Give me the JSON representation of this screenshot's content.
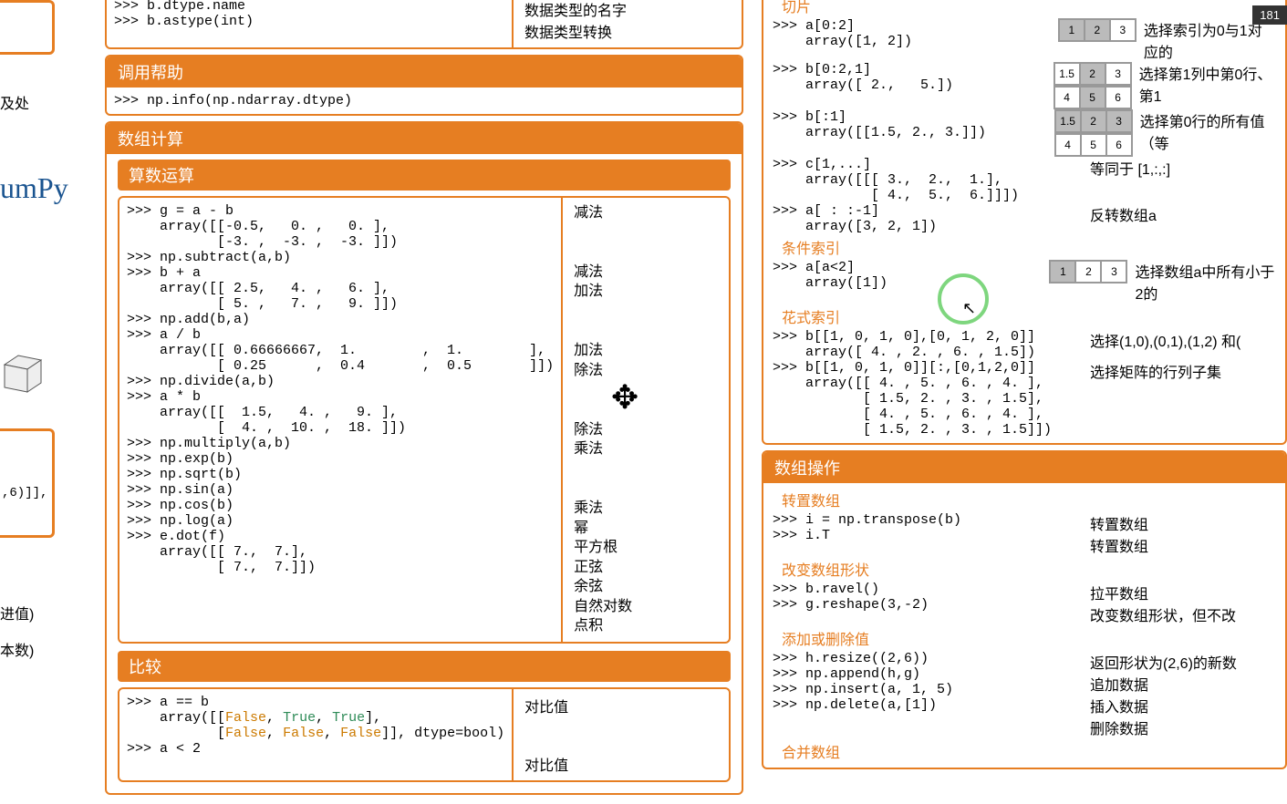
{
  "badge": "181",
  "left": {
    "frag1": "及处",
    "numpy": "umPy",
    "frag2": "进值)",
    "frag3": "本数)"
  },
  "top_code": {
    "l1": ">>> b.dtype.name",
    "l2": ">>> b.astype(int)",
    "d1": "数据类型的名字",
    "d2": "数据类型转换"
  },
  "help": {
    "title": "调用帮助",
    "code": ">>> np.info(np.ndarray.dtype)"
  },
  "calc": {
    "title": "数组计算",
    "arith": {
      "title": "算数运算",
      "code": ">>> g = a - b\n    array([[-0.5,   0. ,   0. ],\n           [-3. ,  -3. ,  -3. ]])\n>>> np.subtract(a,b)\n>>> b + a\n    array([[ 2.5,   4. ,   6. ],\n           [ 5. ,   7. ,   9. ]])\n>>> np.add(b,a)\n>>> a / b\n    array([[ 0.66666667,  1.        ,  1.        ],\n           [ 0.25      ,  0.4       ,  0.5       ]])\n>>> np.divide(a,b)\n>>> a * b\n    array([[  1.5,   4. ,   9. ],\n           [  4. ,  10. ,  18. ]])\n>>> np.multiply(a,b)\n>>> np.exp(b)\n>>> np.sqrt(b)\n>>> np.sin(a)\n>>> np.cos(b)\n>>> np.log(a)\n>>> e.dot(f)\n    array([[ 7.,  7.],\n           [ 7.,  7.]])",
      "desc": "减法\n\n\n减法\n加法\n\n\n加法\n除法\n\n\n除法\n乘法\n\n\n乘法\n幂\n平方根\n正弦\n余弦\n自然对数\n点积"
    },
    "compare": {
      "title": "比较",
      "l1": ">>> a == b",
      "l2a": "    array([[",
      "l2b": ", ",
      "l2c": ", ",
      "l2d": "],",
      "l3a": "           [",
      "l3b": ", ",
      "l3c": ", ",
      "l3d": "]], dtype=bool)",
      "l4": ">>> a < 2",
      "d1": "对比值",
      "d2": "对比值",
      "false": "False",
      "true": "True"
    }
  },
  "slice": {
    "title": "切片",
    "c1": ">>> a[0:2]\n    array([1, 2])",
    "c2": ">>> b[0:2,1]\n    array([ 2.,   5.])",
    "c3": ">>> b[:1]\n    array([[1.5, 2., 3.]])",
    "c4": ">>> c[1,...]\n    array([[[ 3.,  2.,  1.],\n            [ 4.,  5.,  6.]]])",
    "c5": ">>> a[ : :-1]\n    array([3, 2, 1])",
    "d1": "选择索引为0与1对应的",
    "d2": "选择第1列中第0行、第1",
    "d3": "选择第0行的所有值（等",
    "d4": "等同于 [1,:,:]",
    "d5": "反转数组a"
  },
  "cond": {
    "title": "条件索引",
    "code": ">>> a[a<2]\n    array([1])",
    "desc": "选择数组a中所有小于2的"
  },
  "fancy": {
    "title": "花式索引",
    "c1": ">>> b[[1, 0, 1, 0],[0, 1, 2, 0]]\n    array([ 4. , 2. , 6. , 1.5])",
    "c2": ">>> b[[1, 0, 1, 0]][:,[0,1,2,0]]\n    array([[ 4. , 5. , 6. , 4. ],\n           [ 1.5, 2. , 3. , 1.5],\n           [ 4. , 5. , 6. , 4. ],\n           [ 1.5, 2. , 3. , 1.5]])",
    "d1": "选择(1,0),(0,1),(1,2) 和(",
    "d2": "选择矩阵的行列子集"
  },
  "manip": {
    "title": "数组操作",
    "transpose": {
      "title": "转置数组",
      "code": ">>> i = np.transpose(b)\n>>> i.T",
      "d1": "转置数组",
      "d2": "转置数组"
    },
    "reshape": {
      "title": "改变数组形状",
      "code": ">>> b.ravel()\n>>> g.reshape(3,-2)",
      "d1": "拉平数组",
      "d2": "改变数组形状，但不改"
    },
    "addrem": {
      "title": "添加或删除值",
      "code": ">>> h.resize((2,6))\n>>> np.append(h,g)\n>>> np.insert(a, 1, 5)\n>>> np.delete(a,[1])",
      "d1": "返回形状为(2,6)的新数",
      "d2": "追加数据",
      "d3": "插入数据",
      "d4": "删除数据"
    },
    "combine": {
      "title": "合并数组"
    }
  },
  "leftcode": ",6)]],"
}
